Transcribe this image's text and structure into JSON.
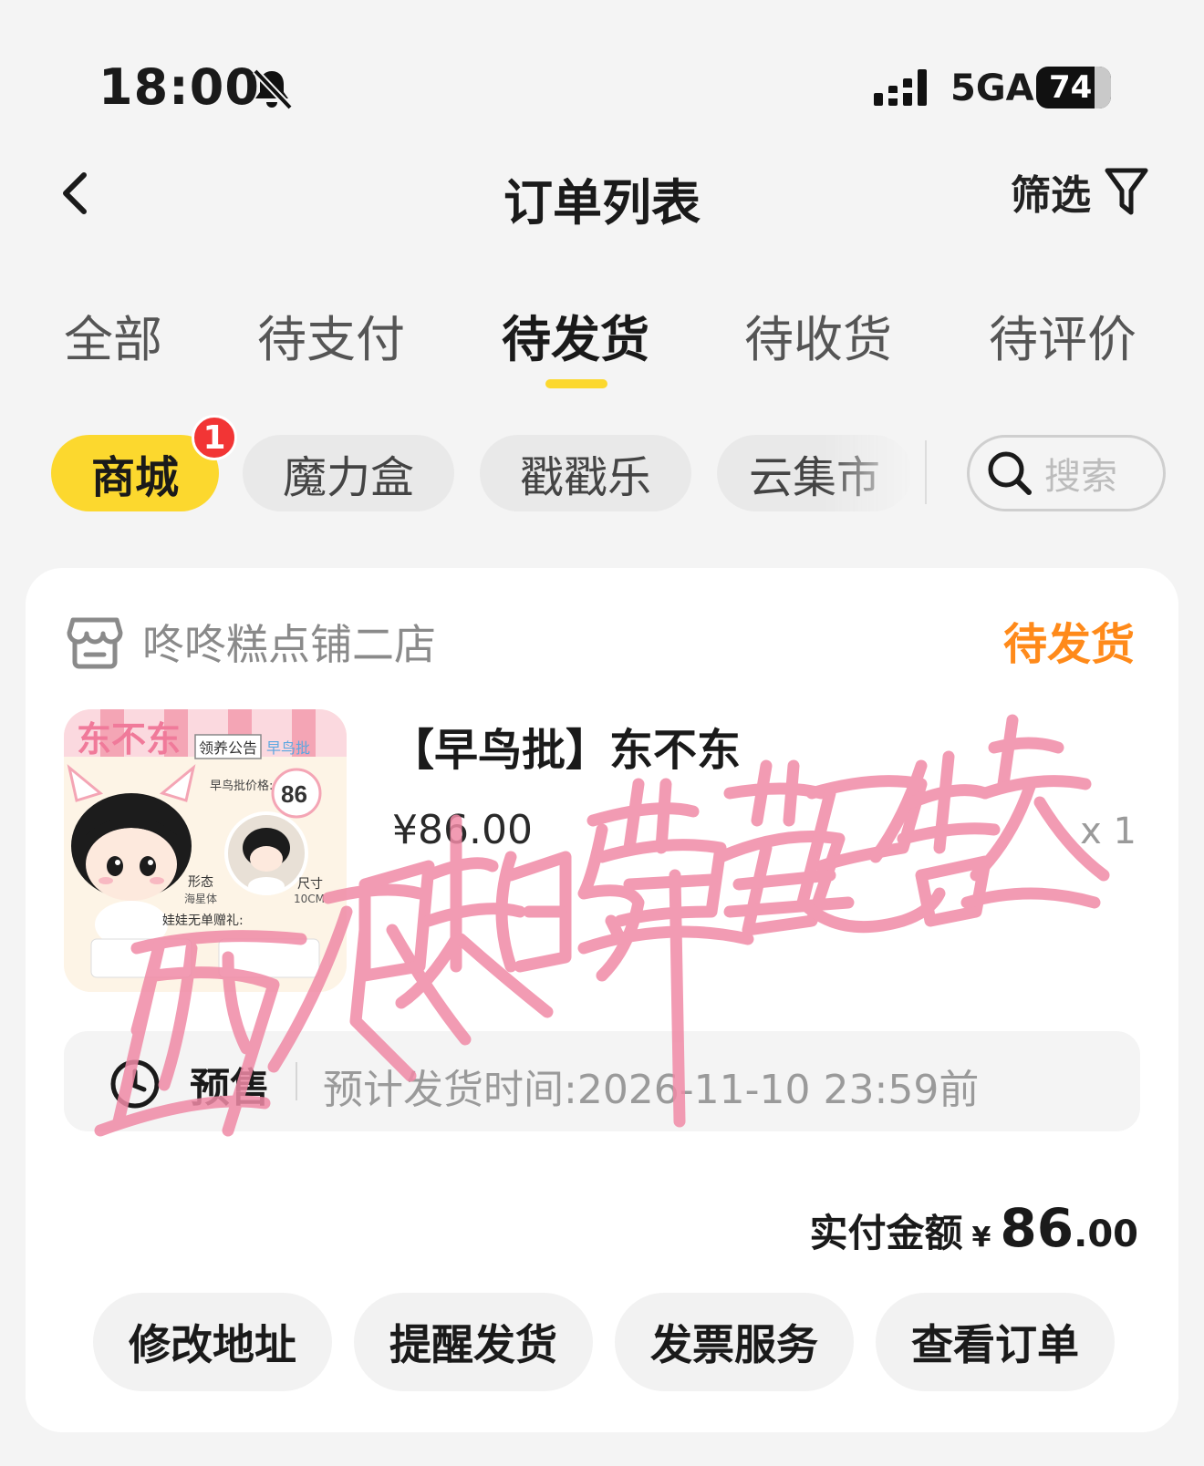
{
  "status_bar": {
    "time": "18:00",
    "network": "5GA",
    "battery": "74"
  },
  "nav": {
    "title": "订单列表",
    "filter_label": "筛选"
  },
  "tabs": [
    {
      "label": "全部"
    },
    {
      "label": "待支付"
    },
    {
      "label": "待发货",
      "active": true
    },
    {
      "label": "待收货"
    },
    {
      "label": "待评价"
    }
  ],
  "chips": [
    {
      "label": "商城",
      "active": true,
      "badge": "1"
    },
    {
      "label": "魔力盒"
    },
    {
      "label": "戳戳乐"
    },
    {
      "label": "云集市"
    }
  ],
  "search": {
    "placeholder": "搜索"
  },
  "order": {
    "shop_name": "咚咚糕点铺二店",
    "status": "待发货",
    "product_title": "【早鸟批】东不东",
    "price": "¥86.00",
    "quantity": "x 1",
    "image_text": {
      "brand": "东不东",
      "notice": "领养公告",
      "early": "早鸟批",
      "price_label": "早鸟批价格:",
      "price_value": "86",
      "form_label": "形态",
      "form_value": "海星体",
      "size_label": "尺寸",
      "size_value": "10CM",
      "gift": "娃娃无单赠礼:"
    },
    "presale_tag": "预售",
    "presale_time": "预计发货时间:2026-11-10 23:59前",
    "paid_label": "实付金额",
    "paid_currency": "¥",
    "paid_integer": "86",
    "paid_decimal": ".00"
  },
  "actions": [
    {
      "label": "修改地址"
    },
    {
      "label": "提醒发货"
    },
    {
      "label": "发票服务"
    },
    {
      "label": "查看订单"
    }
  ],
  "watermark_text": "西瓜味的草莓已售罄",
  "colors": {
    "accent": "#fcd82e",
    "status_orange": "#ff8a1a",
    "badge_red": "#f23535",
    "watermark_pink": "#f08aa6"
  }
}
